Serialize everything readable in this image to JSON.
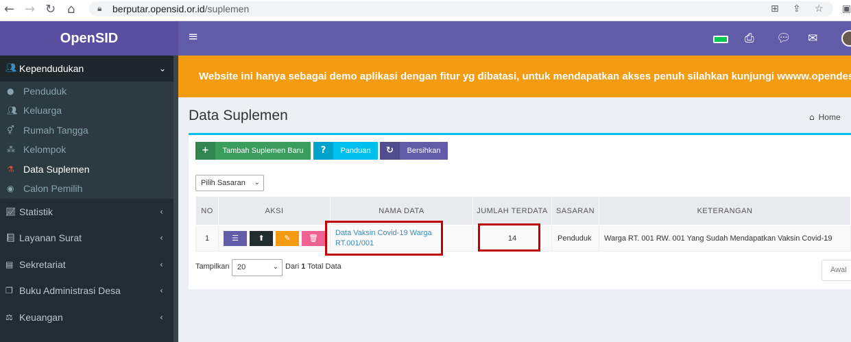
{
  "browser": {
    "url_host": "berputar.opensid.or.id",
    "url_path": "/suplemen"
  },
  "app": {
    "logo": "OpenSID"
  },
  "sidebar": {
    "section": "Kependudukan",
    "sub_items": [
      {
        "label": "Penduduk"
      },
      {
        "label": "Keluarga"
      },
      {
        "label": "Rumah Tangga"
      },
      {
        "label": "Kelompok"
      },
      {
        "label": "Data Suplemen"
      },
      {
        "label": "Calon Pemilih"
      }
    ],
    "main_items": [
      {
        "label": "Statistik"
      },
      {
        "label": "Layanan Surat"
      },
      {
        "label": "Sekretariat"
      },
      {
        "label": "Buku Administrasi Desa"
      },
      {
        "label": "Keuangan"
      }
    ]
  },
  "alert": {
    "text": "Website ini hanya sebagai demo aplikasi dengan fitur yg dibatasi, untuk mendapatkan akses penuh silahkan kunjungi wwww.opendes"
  },
  "page": {
    "title": "Data Suplemen",
    "breadcrumb": "Home"
  },
  "toolbar": {
    "add_label": "Tambah Suplemen Baru",
    "guide_label": "Panduan",
    "clear_label": "Bersihkan"
  },
  "filter": {
    "sasaran_value": "Pilih Sasaran"
  },
  "table": {
    "headers": [
      "NO",
      "AKSI",
      "NAMA DATA",
      "JUMLAH TERDATA",
      "SASARAN",
      "KETERANGAN"
    ],
    "rows": [
      {
        "no": "1",
        "nama_line1": "Data Vaksin Covid-19 Warga",
        "nama_line2": "RT.001/001",
        "jumlah": "14",
        "sasaran": "Penduduk",
        "keterangan": "Warga RT. 001 RW. 001 Yang Sudah Mendapatkan Vaksin Covid-19"
      }
    ]
  },
  "footer": {
    "show_label": "Tampilkan",
    "page_size": "20",
    "summary_pre": "Dari",
    "summary_count": "1",
    "summary_post": "Total Data",
    "first_page": "Awal"
  },
  "colors": {
    "header": "#605ca8",
    "logo": "#5a4ea1",
    "alert": "#f39c12",
    "btn_add": "#3a9d5d",
    "btn_guide": "#00c0ef",
    "btn_clear": "#605ca8",
    "highlight": "#c00000"
  }
}
